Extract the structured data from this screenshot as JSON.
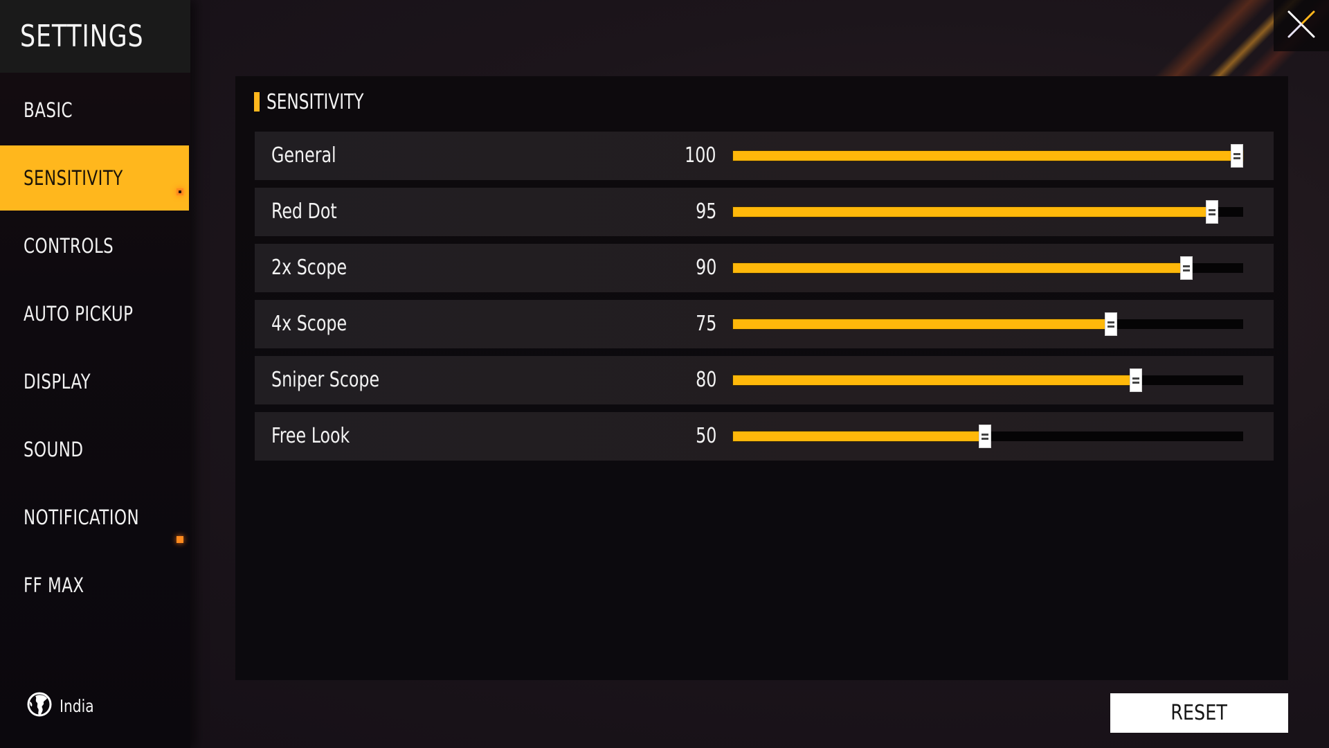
{
  "sidebar": {
    "title": "SETTINGS",
    "items": [
      {
        "label": "BASIC",
        "active": false,
        "badge": false
      },
      {
        "label": "SENSITIVITY",
        "active": true,
        "badge": false
      },
      {
        "label": "CONTROLS",
        "active": false,
        "badge": true
      },
      {
        "label": "AUTO PICKUP",
        "active": false,
        "badge": false
      },
      {
        "label": "DISPLAY",
        "active": false,
        "badge": false
      },
      {
        "label": "SOUND",
        "active": false,
        "badge": false
      },
      {
        "label": "NOTIFICATION",
        "active": false,
        "badge": false
      },
      {
        "label": "FF MAX",
        "active": false,
        "badge": true
      }
    ],
    "region": {
      "label": "India",
      "icon": "globe-icon"
    }
  },
  "panel": {
    "section_title": "SENSITIVITY",
    "settings": [
      {
        "label": "General",
        "value": 100,
        "display": "100",
        "max": 100
      },
      {
        "label": "Red Dot",
        "value": 95,
        "display": "95",
        "max": 100
      },
      {
        "label": "2x Scope",
        "value": 90,
        "display": "90",
        "max": 100
      },
      {
        "label": "4x Scope",
        "value": 75,
        "display": "75",
        "max": 100
      },
      {
        "label": "Sniper Scope",
        "value": 80,
        "display": "80",
        "max": 100
      },
      {
        "label": "Free Look",
        "value": 50,
        "display": "50",
        "max": 100
      }
    ]
  },
  "actions": {
    "reset_label": "RESET",
    "close_icon": "close-icon"
  },
  "colors": {
    "accent": "#ffb71d",
    "slider_fill": "#ffb80a",
    "badge": "#ff8a1e"
  }
}
